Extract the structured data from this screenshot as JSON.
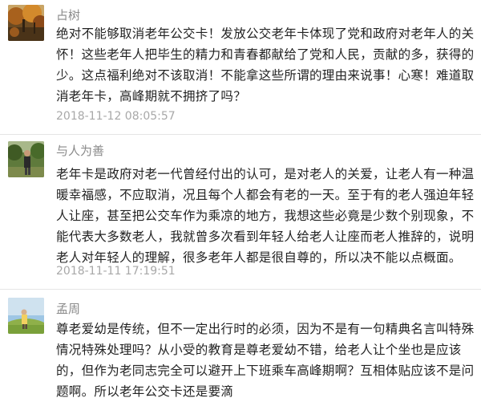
{
  "comments": [
    {
      "username": "占树",
      "avatar_icon": "autumn-landscape-avatar",
      "text": "绝对不能够取消老年公交卡！发放公交老年卡体现了党和政府对老年人的关怀！这些老年人把毕生的精力和青春都献给了党和人民，贡献的多，获得的少。这点福利绝对不该取消！不能拿这些所谓的理由来说事！心寒！难道取消老年卡，高峰期就不拥挤了吗？",
      "timestamp": "2018-11-12 08:05:57"
    },
    {
      "username": "与人为善",
      "avatar_icon": "person-in-garden-avatar",
      "text": "老年卡是政府对老一代曾经付出的认可，是对老人的关爱，让老人有一种温暖幸福感，不应取消，况且每个人都会有老的一天。至于有的老人强迫年轻人让座，甚至把公交车作为乘凉的地方，我想这些必竟是少数个别现象，不能代表大多数老人，我就曾多次看到年轻人给老人让座而老人推辞的，说明老人对年轻人的理解，很多老年人都是很自尊的，所以决不能以点概面。",
      "timestamp": "2018-11-11 17:19:51"
    },
    {
      "username": "孟周",
      "avatar_icon": "meadow-figure-avatar",
      "text": "尊老爱幼是传统，但不一定出行时的必须，因为不是有一句精典名言叫特殊情况特殊处理吗？从小受的教育是尊老爱幼不错，给老人让个坐也是应该的，但作为老同志完全可以避开上下班乘车高峰期啊？互相体贴应该不是问题啊。所以老年公交卡还是要滴"
    }
  ],
  "colors": {
    "username": "#8a8a8a",
    "text": "#222222",
    "timestamp": "#a8a8a8",
    "divider": "#e5e5e5"
  }
}
